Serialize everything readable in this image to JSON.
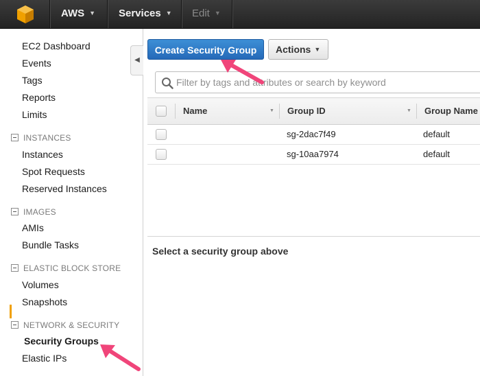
{
  "topbar": {
    "brand": "AWS",
    "services": "Services",
    "edit": "Edit",
    "logo_color": "#f0a000"
  },
  "sidebar": {
    "top_links": [
      "EC2 Dashboard",
      "Events",
      "Tags",
      "Reports",
      "Limits"
    ],
    "sections": [
      {
        "title": "INSTANCES",
        "items": [
          "Instances",
          "Spot Requests",
          "Reserved Instances"
        ]
      },
      {
        "title": "IMAGES",
        "items": [
          "AMIs",
          "Bundle Tasks"
        ]
      },
      {
        "title": "ELASTIC BLOCK STORE",
        "items": [
          "Volumes",
          "Snapshots"
        ]
      },
      {
        "title": "NETWORK & SECURITY",
        "items": [
          "Security Groups",
          "Elastic IPs"
        ]
      }
    ],
    "active_item": "Security Groups"
  },
  "toolbar": {
    "create_button": "Create Security Group",
    "actions_button": "Actions"
  },
  "search": {
    "placeholder": "Filter by tags and attributes or search by keyword"
  },
  "table": {
    "columns": [
      "Name",
      "Group ID",
      "Group Name"
    ],
    "rows": [
      {
        "name": "",
        "group_id": "sg-2dac7f49",
        "group_name": "default"
      },
      {
        "name": "",
        "group_id": "sg-10aa7974",
        "group_name": "default"
      }
    ]
  },
  "detail": {
    "message": "Select a security group above"
  },
  "annotation_color": "#f0457a"
}
